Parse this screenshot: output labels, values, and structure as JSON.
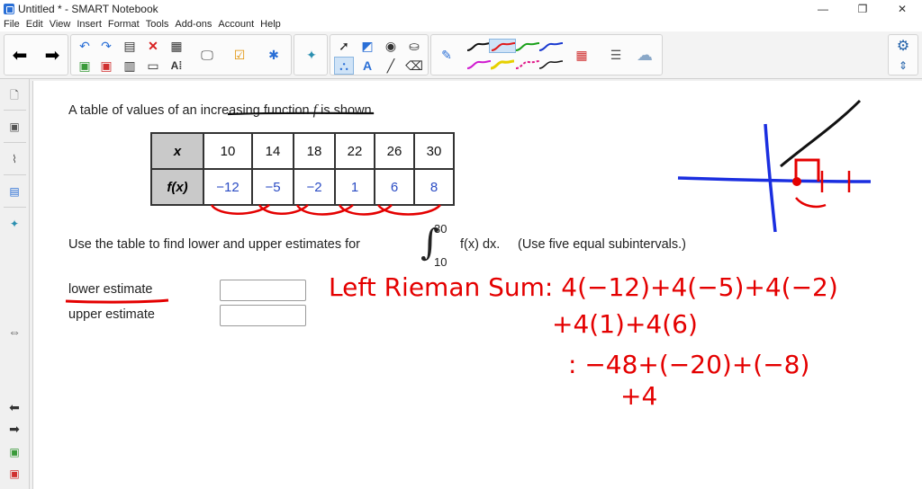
{
  "window": {
    "title": "Untitled * - SMART Notebook",
    "minimize": "—",
    "restore": "❐",
    "close": "✕"
  },
  "menu": [
    "File",
    "Edit",
    "View",
    "Insert",
    "Format",
    "Tools",
    "Add-ons",
    "Account",
    "Help"
  ],
  "toolbar": {
    "icons": [
      "back-arrow-icon",
      "forward-arrow-icon",
      "undo-icon",
      "redo-icon",
      "paste-icon",
      "delete-icon",
      "table-icon",
      "add-page-icon",
      "screen-shade-icon",
      "save-icon",
      "fullscreen-icon",
      "capture-icon",
      "lesson-activity-icon",
      "addons-icon",
      "select-icon",
      "shapes-icon",
      "fill-icon",
      "eraser-pen-icon",
      "text-icon",
      "line-icon",
      "eraser-icon",
      "pen-icon",
      "magic-pen-icon",
      "gear-icon"
    ],
    "accent": "#2a6fd6"
  },
  "question": {
    "intro_pre": "A table of values of an increasing function ",
    "intro_f": "f",
    "intro_post": " is shown.",
    "table": {
      "x_label": "x",
      "fx_label": "f(x)",
      "x_values": [
        "10",
        "14",
        "18",
        "22",
        "26",
        "30"
      ],
      "f_values": [
        "−12",
        "−5",
        "−2",
        "1",
        "6",
        "8"
      ]
    },
    "prompt_pre": "Use the table to find lower and upper estimates for",
    "integral_upper": "30",
    "integral_lower": "10",
    "integrand": "f(x) dx.",
    "prompt_post": "(Use five equal subintervals.)",
    "lower_label": "lower estimate",
    "upper_label": "upper estimate",
    "lower_value": "",
    "upper_value": ""
  },
  "handwriting": {
    "ink_color": "#e40000",
    "line1": "Left Rieman Sum: 4(−12)+4(−5)+4(−2)",
    "line2": "+4(1)+4(6)",
    "line3": ": −48+(−20)+(−8)",
    "line4": "+4"
  }
}
